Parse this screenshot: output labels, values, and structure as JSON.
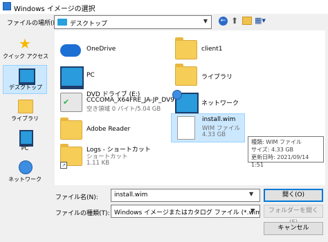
{
  "window": {
    "title": "Windows イメージの選択"
  },
  "location": {
    "label": "ファイルの場所(I):",
    "current": "デスクトップ"
  },
  "toolbar": {
    "back": "←",
    "up": "⬆",
    "view": "▦▾"
  },
  "sidebar": {
    "items": [
      {
        "label": "クイック アクセス",
        "icon": "star-icon"
      },
      {
        "label": "デスクトップ",
        "icon": "desktop-icon",
        "selected": true
      },
      {
        "label": "ライブラリ",
        "icon": "library-folder-icon"
      },
      {
        "label": "PC",
        "icon": "pc-icon"
      },
      {
        "label": "ネットワーク",
        "icon": "network-icon"
      }
    ]
  },
  "files": [
    {
      "name": "OneDrive",
      "icon": "onedrive-cloud-icon"
    },
    {
      "name": "client1",
      "icon": "folder-icon"
    },
    {
      "name": "PC",
      "icon": "pc-icon"
    },
    {
      "name": "ライブラリ",
      "icon": "library-folder-icon"
    },
    {
      "name": "DVD ドライブ (E:)",
      "line2": "CCCOMA_X64FRE_JA-JP_DV9",
      "line3": "空き領域 0 バイト/5.04 GB",
      "icon": "dvd-drive-icon"
    },
    {
      "name": "ネットワーク",
      "icon": "network-icon"
    },
    {
      "name": "Adobe Reader",
      "icon": "folder-icon"
    },
    {
      "name": "install.wim",
      "line2": "WIM ファイル",
      "line3": "4.33 GB",
      "icon": "file-icon",
      "selected": true
    },
    {
      "name": "Logs - ショートカット",
      "line2": "ショートカット",
      "line3": "1.11 KB",
      "icon": "shortcut-folder-icon"
    }
  ],
  "tooltip": {
    "type": "種類: WIM ファイル",
    "size": "サイズ: 4.33 GB",
    "modified": "更新日時: 2021/09/14 1:51"
  },
  "bottom": {
    "filename_label": "ファイル名(N):",
    "filename_value": "install.wim",
    "filetype_label": "ファイルの種類(T):",
    "filetype_value": "Windows イメージまたはカタログ ファイル (*.wim, *.clg)",
    "open_button": "開く(O)",
    "folder_button": "フォルダーを開く(F)",
    "cancel_button": "キャンセル"
  }
}
